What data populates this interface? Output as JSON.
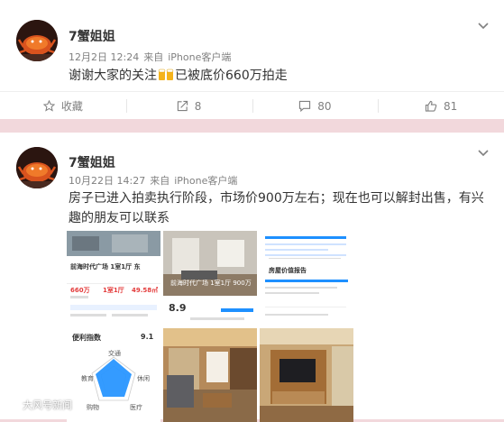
{
  "colors": {
    "page_bg": "#f2d8dc",
    "card_bg": "#ffffff",
    "name": "#333333",
    "meta": "#808080",
    "accent_blue": "#1e90ff",
    "price_red": "#e33b3b"
  },
  "posts": [
    {
      "author": "7蟹姐姐",
      "date": "12月2日 12:24",
      "from": "来自",
      "source": "iPhone客户端",
      "text_before": "谢谢大家的关注",
      "emoji": "beer-cheers-icon",
      "text_after": "已被底价660万拍走",
      "actions": {
        "favorite_label": "收藏",
        "repost_count": "8",
        "comment_count": "80",
        "like_count": "81"
      }
    },
    {
      "author": "7蟹姐姐",
      "date": "10月22日 14:27",
      "from": "来自",
      "source": "iPhone客户端",
      "text": "房子已进入拍卖执行阶段，市场价900万左右；现在也可以解封出售，有兴趣的朋友可以联系",
      "images": {
        "img1_title": "前海时代广场 1室1厅 东",
        "img1_price": "660万",
        "img1_layout": "1室1厅",
        "img1_area": "49.58㎡",
        "img2_title": "前海时代广场 1室1厅 900万",
        "img2_score": "8.9",
        "img3_title": "房屋价值报告",
        "img4_title": "便利指数",
        "img4_score": "9.1",
        "img4_axes": [
          "交通",
          "休闲",
          "医疗",
          "购物",
          "教育"
        ]
      }
    }
  ],
  "watermark": "大风号新闻"
}
